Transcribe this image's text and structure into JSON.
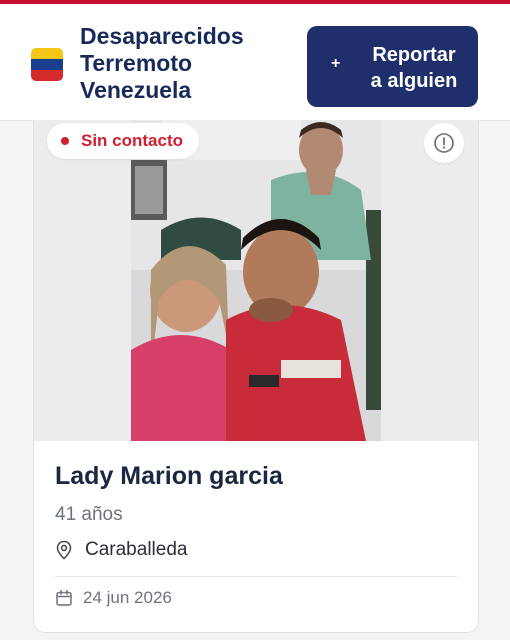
{
  "header": {
    "title_lines": [
      "Desaparecidos",
      "Terremoto",
      "Venezuela"
    ],
    "report_button": {
      "icon": "plus-icon",
      "lines": [
        "Reportar",
        "a alguien"
      ]
    }
  },
  "card": {
    "status": {
      "label": "Sin contacto",
      "color": "#d01f30"
    },
    "info_icon": "info-icon",
    "name": "Lady Marion garcia",
    "age": "41 años",
    "location": {
      "icon": "map-pin-icon",
      "text": "Caraballeda"
    },
    "date": {
      "icon": "calendar-icon",
      "text": "24 jun 2026"
    }
  },
  "colors": {
    "brand": "#1e2f6b",
    "accent": "#c6102e",
    "status_red": "#d01f30"
  }
}
